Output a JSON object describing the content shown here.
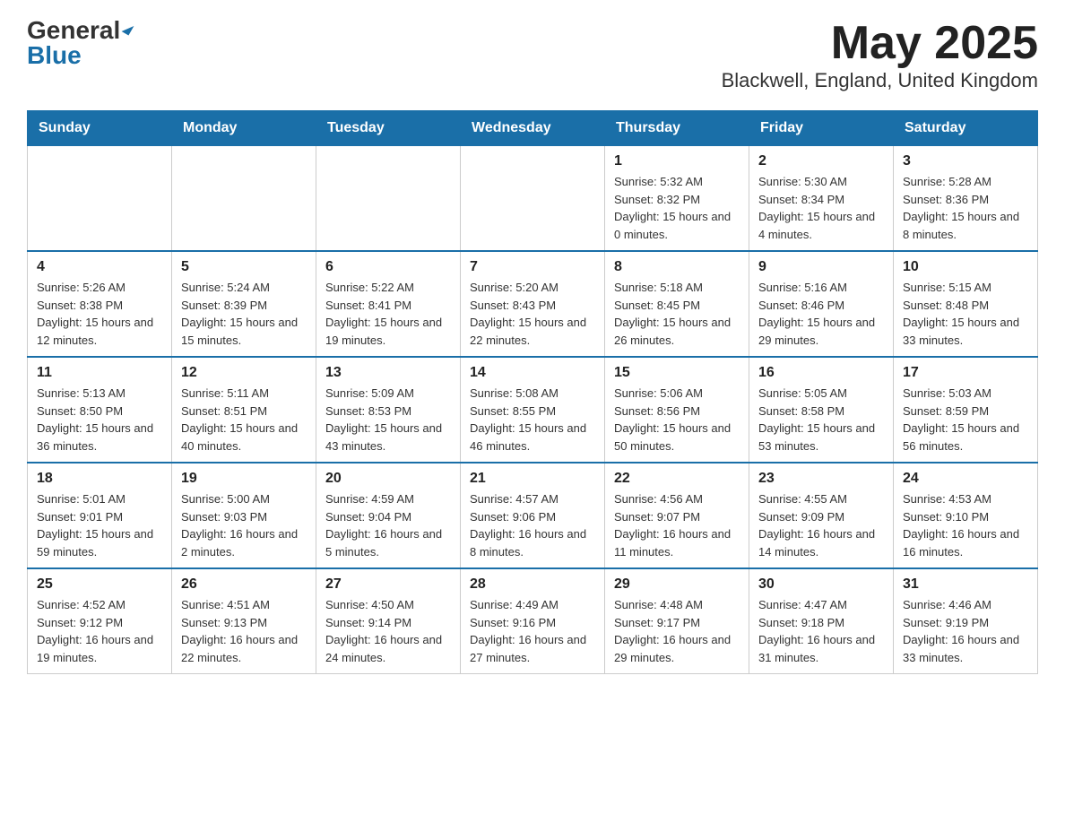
{
  "header": {
    "logo": {
      "general": "General",
      "blue": "Blue",
      "arrow": "▲"
    },
    "title": "May 2025",
    "location": "Blackwell, England, United Kingdom"
  },
  "days_of_week": [
    "Sunday",
    "Monday",
    "Tuesday",
    "Wednesday",
    "Thursday",
    "Friday",
    "Saturday"
  ],
  "weeks": [
    [
      {
        "day": "",
        "sunrise": "",
        "sunset": "",
        "daylight": ""
      },
      {
        "day": "",
        "sunrise": "",
        "sunset": "",
        "daylight": ""
      },
      {
        "day": "",
        "sunrise": "",
        "sunset": "",
        "daylight": ""
      },
      {
        "day": "",
        "sunrise": "",
        "sunset": "",
        "daylight": ""
      },
      {
        "day": "1",
        "sunrise": "Sunrise: 5:32 AM",
        "sunset": "Sunset: 8:32 PM",
        "daylight": "Daylight: 15 hours and 0 minutes."
      },
      {
        "day": "2",
        "sunrise": "Sunrise: 5:30 AM",
        "sunset": "Sunset: 8:34 PM",
        "daylight": "Daylight: 15 hours and 4 minutes."
      },
      {
        "day": "3",
        "sunrise": "Sunrise: 5:28 AM",
        "sunset": "Sunset: 8:36 PM",
        "daylight": "Daylight: 15 hours and 8 minutes."
      }
    ],
    [
      {
        "day": "4",
        "sunrise": "Sunrise: 5:26 AM",
        "sunset": "Sunset: 8:38 PM",
        "daylight": "Daylight: 15 hours and 12 minutes."
      },
      {
        "day": "5",
        "sunrise": "Sunrise: 5:24 AM",
        "sunset": "Sunset: 8:39 PM",
        "daylight": "Daylight: 15 hours and 15 minutes."
      },
      {
        "day": "6",
        "sunrise": "Sunrise: 5:22 AM",
        "sunset": "Sunset: 8:41 PM",
        "daylight": "Daylight: 15 hours and 19 minutes."
      },
      {
        "day": "7",
        "sunrise": "Sunrise: 5:20 AM",
        "sunset": "Sunset: 8:43 PM",
        "daylight": "Daylight: 15 hours and 22 minutes."
      },
      {
        "day": "8",
        "sunrise": "Sunrise: 5:18 AM",
        "sunset": "Sunset: 8:45 PM",
        "daylight": "Daylight: 15 hours and 26 minutes."
      },
      {
        "day": "9",
        "sunrise": "Sunrise: 5:16 AM",
        "sunset": "Sunset: 8:46 PM",
        "daylight": "Daylight: 15 hours and 29 minutes."
      },
      {
        "day": "10",
        "sunrise": "Sunrise: 5:15 AM",
        "sunset": "Sunset: 8:48 PM",
        "daylight": "Daylight: 15 hours and 33 minutes."
      }
    ],
    [
      {
        "day": "11",
        "sunrise": "Sunrise: 5:13 AM",
        "sunset": "Sunset: 8:50 PM",
        "daylight": "Daylight: 15 hours and 36 minutes."
      },
      {
        "day": "12",
        "sunrise": "Sunrise: 5:11 AM",
        "sunset": "Sunset: 8:51 PM",
        "daylight": "Daylight: 15 hours and 40 minutes."
      },
      {
        "day": "13",
        "sunrise": "Sunrise: 5:09 AM",
        "sunset": "Sunset: 8:53 PM",
        "daylight": "Daylight: 15 hours and 43 minutes."
      },
      {
        "day": "14",
        "sunrise": "Sunrise: 5:08 AM",
        "sunset": "Sunset: 8:55 PM",
        "daylight": "Daylight: 15 hours and 46 minutes."
      },
      {
        "day": "15",
        "sunrise": "Sunrise: 5:06 AM",
        "sunset": "Sunset: 8:56 PM",
        "daylight": "Daylight: 15 hours and 50 minutes."
      },
      {
        "day": "16",
        "sunrise": "Sunrise: 5:05 AM",
        "sunset": "Sunset: 8:58 PM",
        "daylight": "Daylight: 15 hours and 53 minutes."
      },
      {
        "day": "17",
        "sunrise": "Sunrise: 5:03 AM",
        "sunset": "Sunset: 8:59 PM",
        "daylight": "Daylight: 15 hours and 56 minutes."
      }
    ],
    [
      {
        "day": "18",
        "sunrise": "Sunrise: 5:01 AM",
        "sunset": "Sunset: 9:01 PM",
        "daylight": "Daylight: 15 hours and 59 minutes."
      },
      {
        "day": "19",
        "sunrise": "Sunrise: 5:00 AM",
        "sunset": "Sunset: 9:03 PM",
        "daylight": "Daylight: 16 hours and 2 minutes."
      },
      {
        "day": "20",
        "sunrise": "Sunrise: 4:59 AM",
        "sunset": "Sunset: 9:04 PM",
        "daylight": "Daylight: 16 hours and 5 minutes."
      },
      {
        "day": "21",
        "sunrise": "Sunrise: 4:57 AM",
        "sunset": "Sunset: 9:06 PM",
        "daylight": "Daylight: 16 hours and 8 minutes."
      },
      {
        "day": "22",
        "sunrise": "Sunrise: 4:56 AM",
        "sunset": "Sunset: 9:07 PM",
        "daylight": "Daylight: 16 hours and 11 minutes."
      },
      {
        "day": "23",
        "sunrise": "Sunrise: 4:55 AM",
        "sunset": "Sunset: 9:09 PM",
        "daylight": "Daylight: 16 hours and 14 minutes."
      },
      {
        "day": "24",
        "sunrise": "Sunrise: 4:53 AM",
        "sunset": "Sunset: 9:10 PM",
        "daylight": "Daylight: 16 hours and 16 minutes."
      }
    ],
    [
      {
        "day": "25",
        "sunrise": "Sunrise: 4:52 AM",
        "sunset": "Sunset: 9:12 PM",
        "daylight": "Daylight: 16 hours and 19 minutes."
      },
      {
        "day": "26",
        "sunrise": "Sunrise: 4:51 AM",
        "sunset": "Sunset: 9:13 PM",
        "daylight": "Daylight: 16 hours and 22 minutes."
      },
      {
        "day": "27",
        "sunrise": "Sunrise: 4:50 AM",
        "sunset": "Sunset: 9:14 PM",
        "daylight": "Daylight: 16 hours and 24 minutes."
      },
      {
        "day": "28",
        "sunrise": "Sunrise: 4:49 AM",
        "sunset": "Sunset: 9:16 PM",
        "daylight": "Daylight: 16 hours and 27 minutes."
      },
      {
        "day": "29",
        "sunrise": "Sunrise: 4:48 AM",
        "sunset": "Sunset: 9:17 PM",
        "daylight": "Daylight: 16 hours and 29 minutes."
      },
      {
        "day": "30",
        "sunrise": "Sunrise: 4:47 AM",
        "sunset": "Sunset: 9:18 PM",
        "daylight": "Daylight: 16 hours and 31 minutes."
      },
      {
        "day": "31",
        "sunrise": "Sunrise: 4:46 AM",
        "sunset": "Sunset: 9:19 PM",
        "daylight": "Daylight: 16 hours and 33 minutes."
      }
    ]
  ]
}
